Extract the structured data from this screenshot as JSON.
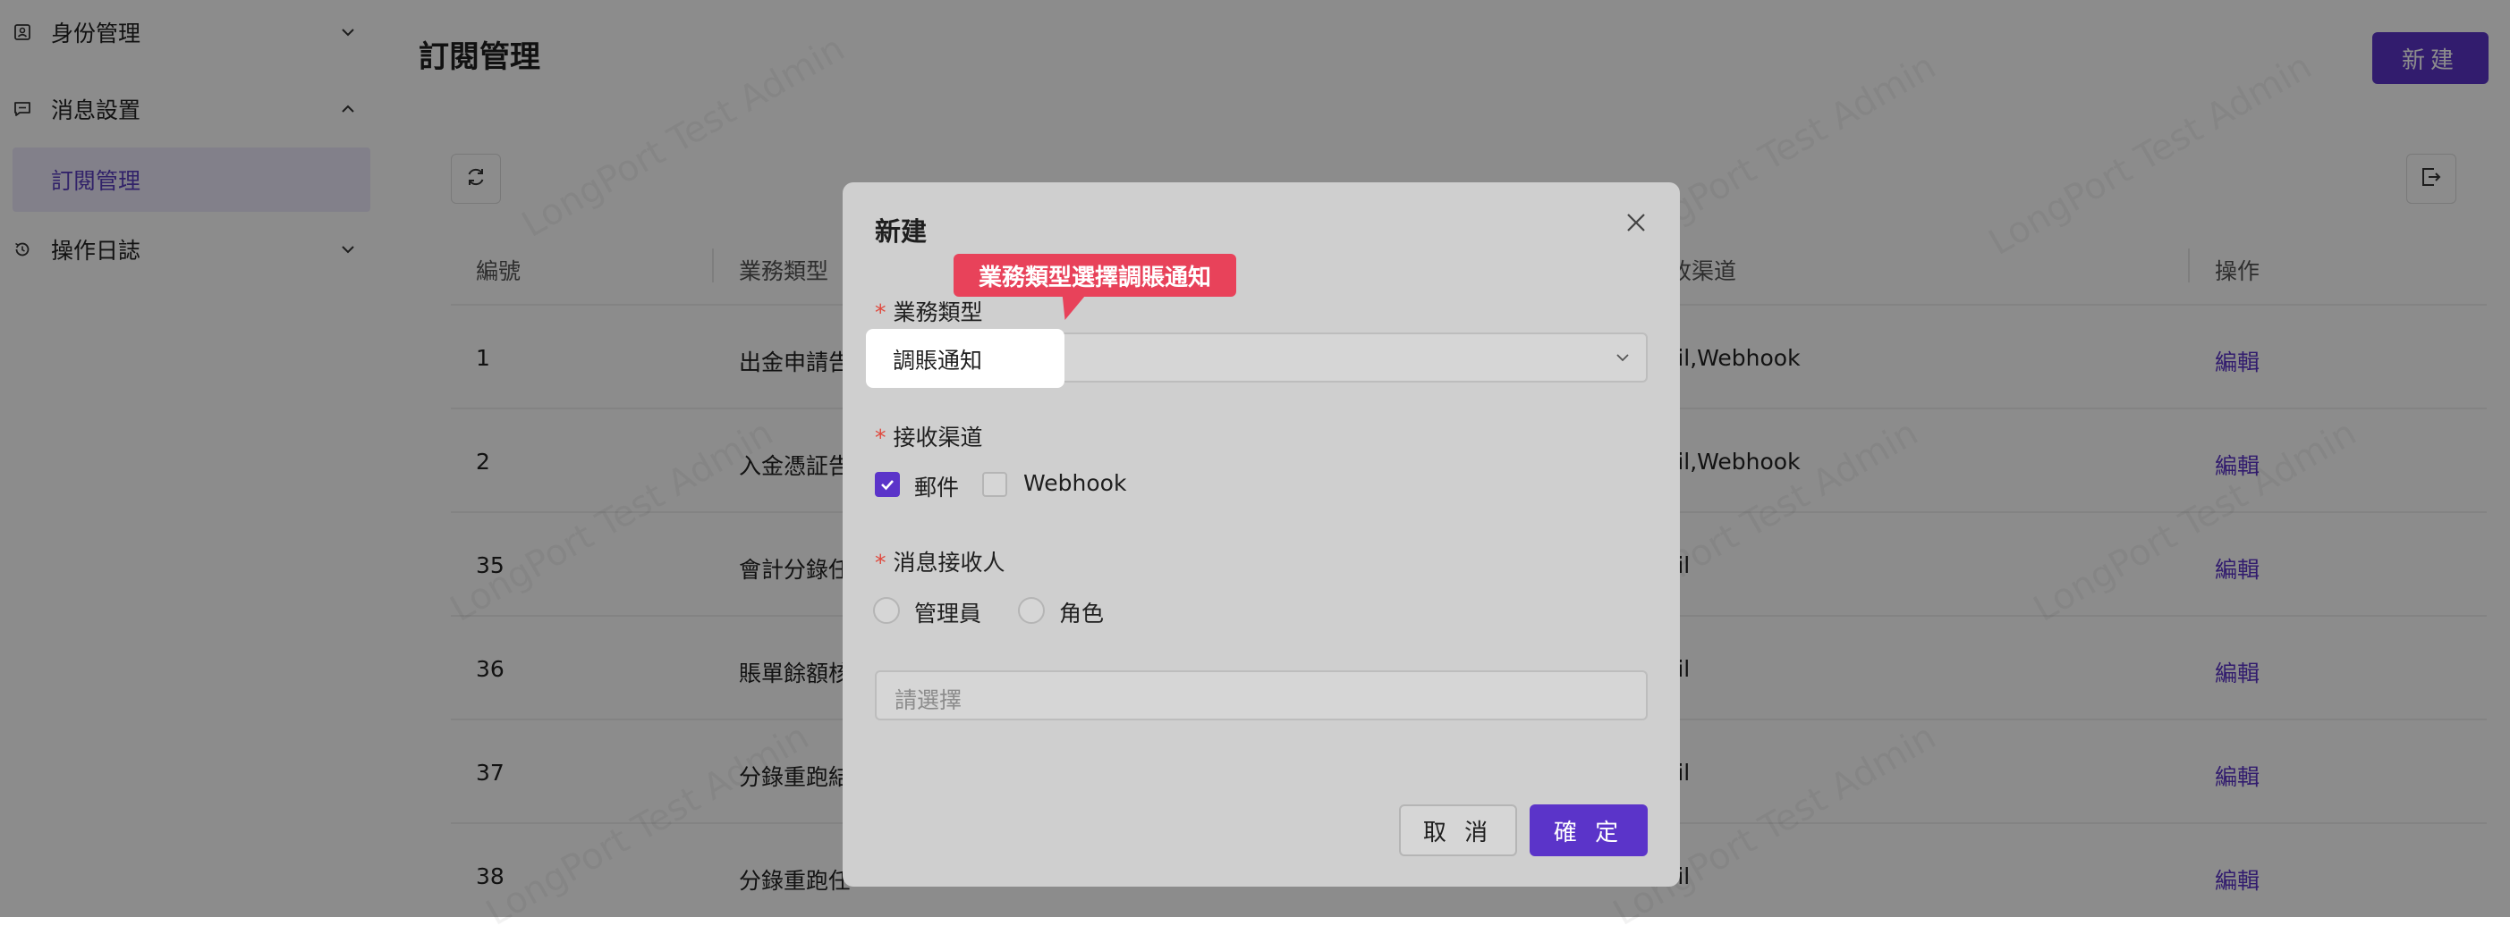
{
  "sidebar": {
    "items": [
      {
        "label": "身份管理",
        "icon": "id-card-icon",
        "expanded": false
      },
      {
        "label": "消息設置",
        "icon": "message-icon",
        "expanded": true
      },
      {
        "label": "訂閱管理",
        "active": true
      },
      {
        "label": "操作日誌",
        "icon": "history-icon",
        "expanded": false
      }
    ]
  },
  "header": {
    "title": "訂閱管理",
    "new_label": "新建"
  },
  "watermark_text": "LongPort Test Admin",
  "table": {
    "headers": [
      "編號",
      "業務類型",
      "接收渠道",
      "操作"
    ],
    "rows": [
      {
        "id": "1",
        "type": "出金申請告",
        "channel": "ail,Webhook",
        "action": "編輯"
      },
      {
        "id": "2",
        "type": "入金憑証告",
        "channel": "ail,Webhook",
        "action": "編輯"
      },
      {
        "id": "35",
        "type": "會計分錄任",
        "channel": "ail",
        "action": "編輯"
      },
      {
        "id": "36",
        "type": "賬單餘額核",
        "channel": "ail",
        "action": "編輯"
      },
      {
        "id": "37",
        "type": "分錄重跑結",
        "channel": "ail",
        "action": "編輯"
      },
      {
        "id": "38",
        "type": "分錄重跑任",
        "channel": "ail",
        "action": "編輯"
      }
    ],
    "header_channel_visible": "收渠道"
  },
  "modal": {
    "title": "新建",
    "callout": "業務類型選擇調賬通知",
    "business_type": {
      "label": "業務類型",
      "value": "調賬通知"
    },
    "channels": {
      "label": "接收渠道",
      "options": [
        {
          "label": "郵件",
          "checked": true
        },
        {
          "label": "Webhook",
          "checked": false
        }
      ]
    },
    "recipients": {
      "label": "消息接收人",
      "options": [
        {
          "label": "管理員",
          "selected": false
        },
        {
          "label": "角色",
          "selected": false
        }
      ],
      "placeholder": "請選擇"
    },
    "cancel_label": "取 消",
    "ok_label": "確 定"
  },
  "colors": {
    "accent": "#5b34c9",
    "callout": "#e8425a",
    "required": "#e0483c"
  }
}
